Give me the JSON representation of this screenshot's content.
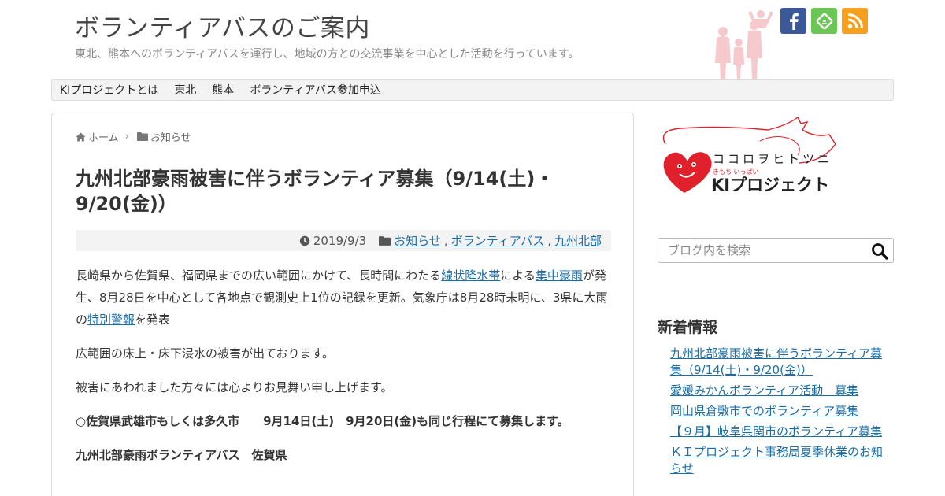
{
  "header": {
    "site_title": "ボランティアバスのご案内",
    "site_description": "東北、熊本へのボランティアバスを運行し、地域の方との交流事業を中心とした活動を行っています。",
    "social_icons": [
      "facebook-icon",
      "feedly-icon",
      "rss-icon"
    ]
  },
  "nav": {
    "items": [
      {
        "label": "KIプロジェクトとは"
      },
      {
        "label": "東北"
      },
      {
        "label": "熊本"
      },
      {
        "label": "ボランティアバス参加申込"
      }
    ]
  },
  "breadcrumb": {
    "home": "ホーム",
    "category": "お知らせ"
  },
  "article": {
    "title": "九州北部豪雨被害に伴うボランティア募集（9/14(土)・9/20(金)）",
    "date": "2019/9/3",
    "categories": [
      "お知らせ",
      "ボランティアバス",
      "九州北部"
    ],
    "p1": {
      "t1": "長崎県から佐賀県、福岡県までの広い範囲にかけて、長時間にわたる",
      "link1": "線状降水帯",
      "t2": "による",
      "link2": "集中豪雨",
      "t3": "が発生、8月28日を中心として各地点で観測史上1位の記録を更新。気象庁は8月28時未明に、3県に大雨の",
      "link3": "特別警報",
      "t4": "を発表"
    },
    "p2": "広範囲の床上・床下浸水の被害が出ております。",
    "p3": "被害にあわれました方々には心よりお見舞い申し上げます。",
    "p4": "○佐賀県武雄市もしくは多久市　　9月14日(土)　9月20日(金)も同じ行程にて募集します。",
    "p5": "九州北部豪雨ボランティアバス　佐賀県"
  },
  "sidebar": {
    "logo_text": {
      "kana": "ココロヲヒトツニ",
      "sub": "きもち いっぱい",
      "name": "KIプロジェクト"
    },
    "search": {
      "placeholder": "ブログ内を検索"
    },
    "recent_title": "新着情報",
    "recent_posts": [
      {
        "label": "九州北部豪雨被害に伴うボランティア募集（9/14(土)・9/20(金)）"
      },
      {
        "label": "愛媛みかんボランティア活動　募集"
      },
      {
        "label": "岡山県倉敷市でのボランティア募集"
      },
      {
        "label": "【９月】岐阜県関市のボランティア募集"
      },
      {
        "label": "ＫＩプロジェクト事務局夏季休業のお知らせ"
      }
    ]
  },
  "colors": {
    "link": "#1a6ea8",
    "facebook": "#3b5998",
    "feedly": "#6cc655",
    "rss": "#f7a01d",
    "logo_red": "#e0202a"
  }
}
